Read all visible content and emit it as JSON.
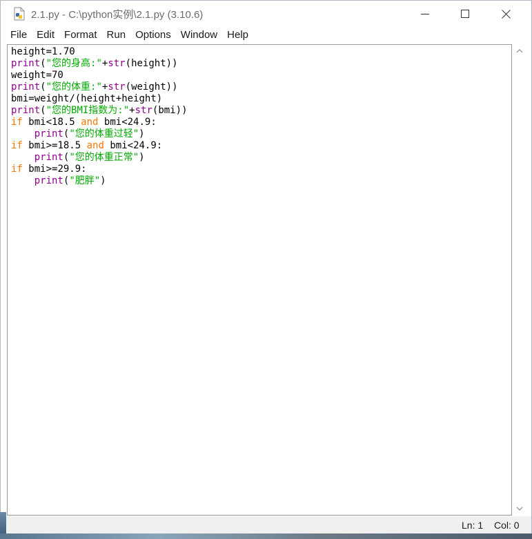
{
  "window": {
    "title": "2.1.py - C:\\python实例\\2.1.py (3.10.6)"
  },
  "menu": [
    {
      "label": "File"
    },
    {
      "label": "Edit"
    },
    {
      "label": "Format"
    },
    {
      "label": "Run"
    },
    {
      "label": "Options"
    },
    {
      "label": "Window"
    },
    {
      "label": "Help"
    }
  ],
  "editor": {
    "lines": [
      "height=1.70",
      "print(\"您的身高:\"+str(height))",
      "weight=70",
      "print(\"您的体重:\"+str(weight))",
      "bmi=weight/(height+height)",
      "print(\"您的BMI指数为:\"+str(bmi))",
      "if bmi<18.5 and bmi<24.9:",
      "    print(\"您的体重过轻\")",
      "if bmi>=18.5 and bmi<24.9:",
      "    print(\"您的体重正常\")",
      "if bmi>=29.9:",
      "    print(\"肥胖\")"
    ]
  },
  "status": {
    "ln": "Ln: 1",
    "col": "Col: 0"
  },
  "colors": {
    "keyword": "#ff7700",
    "builtin": "#900090",
    "string": "#00aa00"
  },
  "icons": {
    "app": "python-file-icon",
    "minimize": "minimize-icon",
    "maximize": "maximize-icon",
    "close": "close-icon",
    "scroll_up": "chevron-up-icon",
    "scroll_down": "chevron-down-icon"
  }
}
